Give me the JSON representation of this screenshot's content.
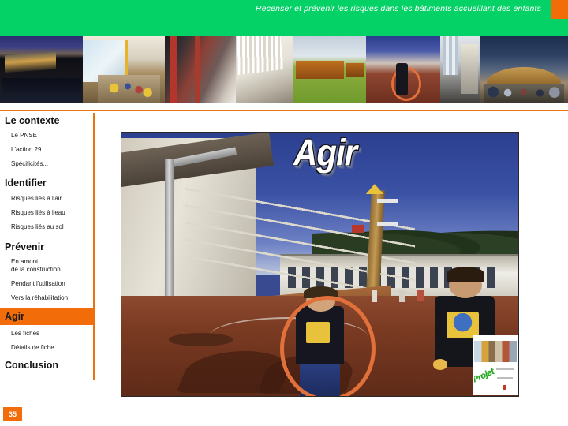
{
  "header": {
    "title": "Recenser et prévenir les risques dans les bâtiments accueillant des enfants",
    "bg_color": "#04d166",
    "accent_color": "#f36c0a"
  },
  "photo_strip": {
    "caption": "bandeau de photographies de bâtiments scolaires",
    "images": [
      {
        "name": "ecole-bord-de-l-eau"
      },
      {
        "name": "salle-de-classe"
      },
      {
        "name": "facade-acier-rouge"
      },
      {
        "name": "verriere-blanche"
      },
      {
        "name": "batiment-modulaire-bois"
      },
      {
        "name": "enfant-au-cerceau"
      },
      {
        "name": "atrium-escalier"
      },
      {
        "name": "pavillon-bois-courbe"
      }
    ]
  },
  "sidebar": {
    "border_color": "#e8730f",
    "active_bg": "#f36c0a",
    "sections": [
      {
        "title": "Le contexte",
        "active": false,
        "items": [
          "Le PNSE",
          "L'action 29",
          "Spécificités..."
        ]
      },
      {
        "title": "Identifier",
        "active": false,
        "items": [
          "Risques liés à l'air",
          "Risques liés à l'eau",
          "Risques liés au sol"
        ]
      },
      {
        "title": "Prévenir",
        "active": false,
        "items": [
          "En amont\nde la construction",
          "Pendant l'utilisation",
          "Vers la réhabilitation"
        ]
      },
      {
        "title": "Agir",
        "active": true,
        "items": [
          "Les fiches",
          "Détails de fiche"
        ]
      },
      {
        "title": "Conclusion",
        "active": false,
        "items": []
      }
    ]
  },
  "main": {
    "wordart_title": "Agir",
    "photo_name": "cour-d-ecole-enfants-avec-cerceau",
    "thumbnail": {
      "name": "brochure-miniature",
      "word": "Projet"
    }
  },
  "footer": {
    "slide_number": "35"
  }
}
